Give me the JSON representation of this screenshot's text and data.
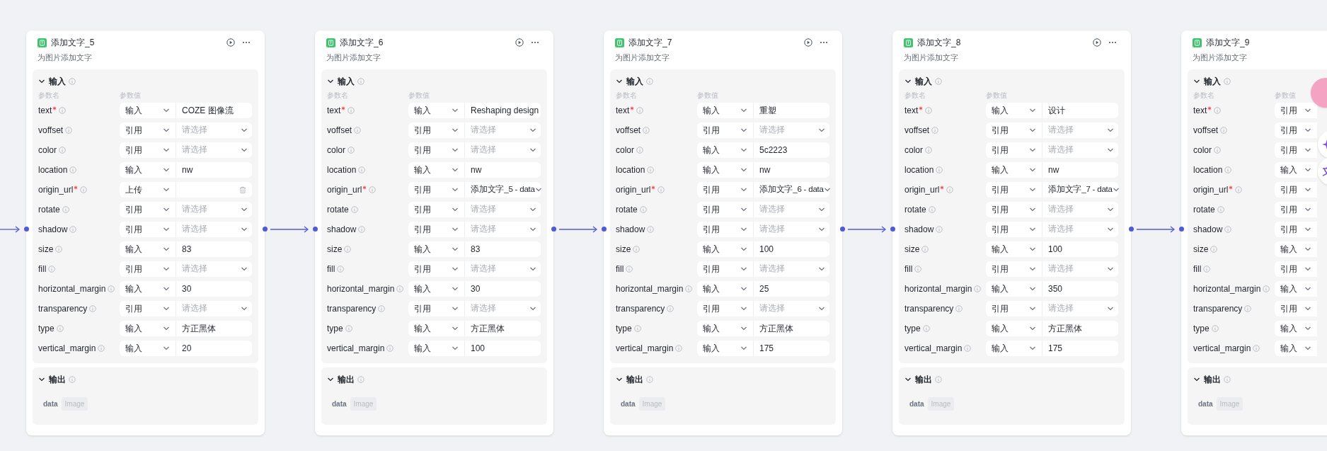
{
  "nodes": [
    {
      "title": "添加文字_5",
      "subtitle": "为图片添加文字",
      "actions_visible": true,
      "input_label": "输入",
      "name_header": "参数名",
      "value_header": "参数值",
      "output_label": "输出",
      "outputs": [
        {
          "name": "data",
          "type": "Image"
        }
      ],
      "params": [
        {
          "name": "text",
          "required": true,
          "mode": "输入",
          "kind": "input",
          "value": "COZE 图像流"
        },
        {
          "name": "voffset",
          "required": false,
          "mode": "引用",
          "kind": "ref",
          "placeholder": "请选择"
        },
        {
          "name": "color",
          "required": false,
          "mode": "引用",
          "kind": "ref",
          "placeholder": "请选择"
        },
        {
          "name": "location",
          "required": false,
          "mode": "输入",
          "kind": "input",
          "value": "nw"
        },
        {
          "name": "origin_url",
          "required": true,
          "mode": "上传",
          "kind": "upload"
        },
        {
          "name": "rotate",
          "required": false,
          "mode": "引用",
          "kind": "ref",
          "placeholder": "请选择"
        },
        {
          "name": "shadow",
          "required": false,
          "mode": "引用",
          "kind": "ref",
          "placeholder": "请选择"
        },
        {
          "name": "size",
          "required": false,
          "mode": "输入",
          "kind": "input",
          "value": "83"
        },
        {
          "name": "fill",
          "required": false,
          "mode": "引用",
          "kind": "ref",
          "placeholder": "请选择"
        },
        {
          "name": "horizontal_margin",
          "required": false,
          "mode": "输入",
          "kind": "input",
          "value": "30"
        },
        {
          "name": "transparency",
          "required": false,
          "mode": "引用",
          "kind": "ref",
          "placeholder": "请选择"
        },
        {
          "name": "type",
          "required": false,
          "mode": "输入",
          "kind": "input",
          "value": "方正黑体"
        },
        {
          "name": "vertical_margin",
          "required": false,
          "mode": "输入",
          "kind": "input",
          "value": "20"
        }
      ]
    },
    {
      "title": "添加文字_6",
      "subtitle": "为图片添加文字",
      "actions_visible": true,
      "input_label": "输入",
      "name_header": "参数名",
      "value_header": "参数值",
      "output_label": "输出",
      "outputs": [
        {
          "name": "data",
          "type": "Image"
        }
      ],
      "params": [
        {
          "name": "text",
          "required": true,
          "mode": "输入",
          "kind": "input",
          "value": "Reshaping design"
        },
        {
          "name": "voffset",
          "required": false,
          "mode": "引用",
          "kind": "ref",
          "placeholder": "请选择"
        },
        {
          "name": "color",
          "required": false,
          "mode": "引用",
          "kind": "ref",
          "placeholder": "请选择"
        },
        {
          "name": "location",
          "required": false,
          "mode": "输入",
          "kind": "input",
          "value": "nw"
        },
        {
          "name": "origin_url",
          "required": true,
          "mode": "引用",
          "kind": "ref",
          "value": "添加文字_5 - data"
        },
        {
          "name": "rotate",
          "required": false,
          "mode": "引用",
          "kind": "ref",
          "placeholder": "请选择"
        },
        {
          "name": "shadow",
          "required": false,
          "mode": "引用",
          "kind": "ref",
          "placeholder": "请选择"
        },
        {
          "name": "size",
          "required": false,
          "mode": "输入",
          "kind": "input",
          "value": "83"
        },
        {
          "name": "fill",
          "required": false,
          "mode": "引用",
          "kind": "ref",
          "placeholder": "请选择"
        },
        {
          "name": "horizontal_margin",
          "required": false,
          "mode": "输入",
          "kind": "input",
          "value": "30"
        },
        {
          "name": "transparency",
          "required": false,
          "mode": "引用",
          "kind": "ref",
          "placeholder": "请选择"
        },
        {
          "name": "type",
          "required": false,
          "mode": "输入",
          "kind": "input",
          "value": "方正黑体"
        },
        {
          "name": "vertical_margin",
          "required": false,
          "mode": "输入",
          "kind": "input",
          "value": "100"
        }
      ]
    },
    {
      "title": "添加文字_7",
      "subtitle": "为图片添加文字",
      "actions_visible": true,
      "input_label": "输入",
      "name_header": "参数名",
      "value_header": "参数值",
      "output_label": "输出",
      "outputs": [
        {
          "name": "data",
          "type": "Image"
        }
      ],
      "params": [
        {
          "name": "text",
          "required": true,
          "mode": "输入",
          "kind": "input",
          "value": "重塑"
        },
        {
          "name": "voffset",
          "required": false,
          "mode": "引用",
          "kind": "ref",
          "placeholder": "请选择"
        },
        {
          "name": "color",
          "required": false,
          "mode": "输入",
          "kind": "input",
          "value": "5c2223"
        },
        {
          "name": "location",
          "required": false,
          "mode": "输入",
          "kind": "input",
          "value": "nw"
        },
        {
          "name": "origin_url",
          "required": true,
          "mode": "引用",
          "kind": "ref",
          "value": "添加文字_6 - data"
        },
        {
          "name": "rotate",
          "required": false,
          "mode": "引用",
          "kind": "ref",
          "placeholder": "请选择"
        },
        {
          "name": "shadow",
          "required": false,
          "mode": "引用",
          "kind": "ref",
          "placeholder": "请选择"
        },
        {
          "name": "size",
          "required": false,
          "mode": "输入",
          "kind": "input",
          "value": "100"
        },
        {
          "name": "fill",
          "required": false,
          "mode": "引用",
          "kind": "ref",
          "placeholder": "请选择"
        },
        {
          "name": "horizontal_margin",
          "required": false,
          "mode": "输入",
          "kind": "input",
          "value": "25"
        },
        {
          "name": "transparency",
          "required": false,
          "mode": "引用",
          "kind": "ref",
          "placeholder": "请选择"
        },
        {
          "name": "type",
          "required": false,
          "mode": "输入",
          "kind": "input",
          "value": "方正黑体"
        },
        {
          "name": "vertical_margin",
          "required": false,
          "mode": "输入",
          "kind": "input",
          "value": "175"
        }
      ]
    },
    {
      "title": "添加文字_8",
      "subtitle": "为图片添加文字",
      "actions_visible": true,
      "input_label": "输入",
      "name_header": "参数名",
      "value_header": "参数值",
      "output_label": "输出",
      "outputs": [
        {
          "name": "data",
          "type": "Image"
        }
      ],
      "params": [
        {
          "name": "text",
          "required": true,
          "mode": "输入",
          "kind": "input",
          "value": "设计"
        },
        {
          "name": "voffset",
          "required": false,
          "mode": "引用",
          "kind": "ref",
          "placeholder": "请选择"
        },
        {
          "name": "color",
          "required": false,
          "mode": "引用",
          "kind": "ref",
          "placeholder": "请选择"
        },
        {
          "name": "location",
          "required": false,
          "mode": "输入",
          "kind": "input",
          "value": "nw"
        },
        {
          "name": "origin_url",
          "required": true,
          "mode": "引用",
          "kind": "ref",
          "value": "添加文字_7 - data"
        },
        {
          "name": "rotate",
          "required": false,
          "mode": "引用",
          "kind": "ref",
          "placeholder": "请选择"
        },
        {
          "name": "shadow",
          "required": false,
          "mode": "引用",
          "kind": "ref",
          "placeholder": "请选择"
        },
        {
          "name": "size",
          "required": false,
          "mode": "输入",
          "kind": "input",
          "value": "100"
        },
        {
          "name": "fill",
          "required": false,
          "mode": "引用",
          "kind": "ref",
          "placeholder": "请选择"
        },
        {
          "name": "horizontal_margin",
          "required": false,
          "mode": "输入",
          "kind": "input",
          "value": "350"
        },
        {
          "name": "transparency",
          "required": false,
          "mode": "引用",
          "kind": "ref",
          "placeholder": "请选择"
        },
        {
          "name": "type",
          "required": false,
          "mode": "输入",
          "kind": "input",
          "value": "方正黑体"
        },
        {
          "name": "vertical_margin",
          "required": false,
          "mode": "输入",
          "kind": "input",
          "value": "175"
        }
      ]
    },
    {
      "title": "添加文字_9",
      "subtitle": "为图片添加文字",
      "actions_visible": false,
      "input_label": "输入",
      "name_header": "参数名",
      "value_header": "参数值",
      "output_label": "输出",
      "outputs": [
        {
          "name": "data",
          "type": "Image"
        }
      ],
      "params": [
        {
          "name": "text",
          "required": true,
          "mode": "引用"
        },
        {
          "name": "voffset",
          "required": false,
          "mode": "引用"
        },
        {
          "name": "color",
          "required": false,
          "mode": "引用"
        },
        {
          "name": "location",
          "required": false,
          "mode": "输入"
        },
        {
          "name": "origin_url",
          "required": true,
          "mode": "引用"
        },
        {
          "name": "rotate",
          "required": false,
          "mode": "引用"
        },
        {
          "name": "shadow",
          "required": false,
          "mode": "引用"
        },
        {
          "name": "size",
          "required": false,
          "mode": "输入"
        },
        {
          "name": "fill",
          "required": false,
          "mode": "引用"
        },
        {
          "name": "horizontal_margin",
          "required": false,
          "mode": "输入"
        },
        {
          "name": "transparency",
          "required": false,
          "mode": "引用"
        },
        {
          "name": "type",
          "required": false,
          "mode": "输入"
        },
        {
          "name": "vertical_margin",
          "required": false,
          "mode": "输入"
        }
      ]
    }
  ]
}
